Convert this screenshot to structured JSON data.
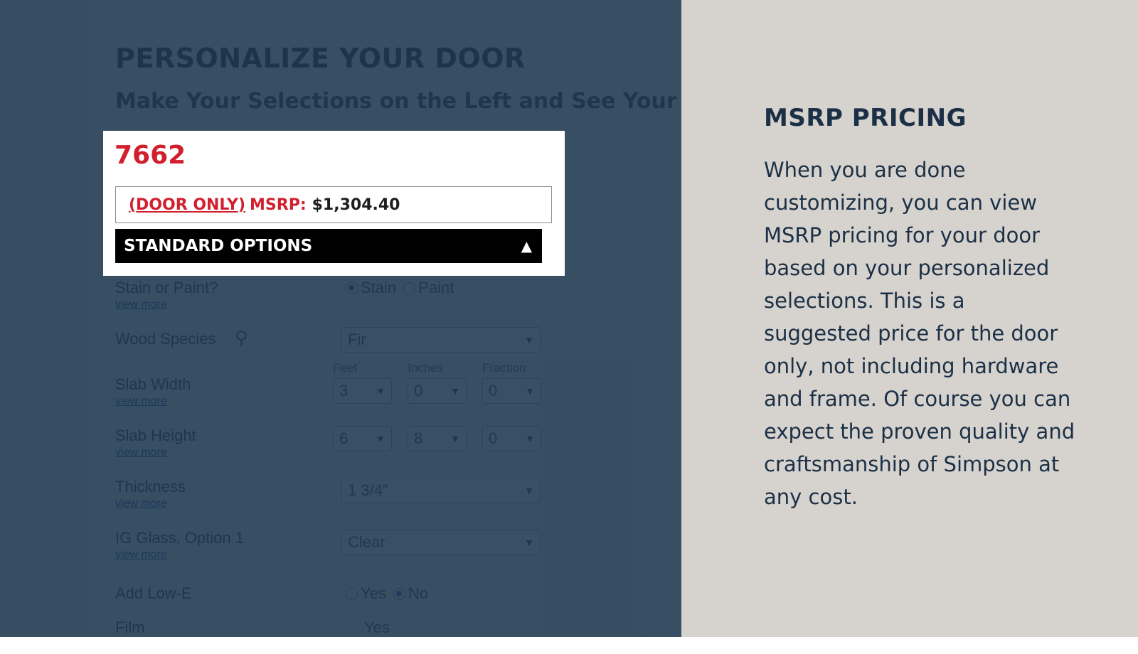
{
  "configurator": {
    "page_title": "PERSONALIZE YOUR DOOR",
    "page_subtitle": "Make Your Selections on the Left and See Your",
    "view_more": "view more",
    "stain_or_paint": {
      "label": "Stain or Paint?",
      "options": [
        "Stain",
        "Paint"
      ],
      "selected": "Stain"
    },
    "wood_species": {
      "label": "Wood Species",
      "value": "Fir"
    },
    "dimension_headers": [
      "Feet",
      "Inches",
      "Fraction"
    ],
    "slab_width": {
      "label": "Slab Width",
      "values": [
        "3",
        "0",
        "0"
      ]
    },
    "slab_height": {
      "label": "Slab Height",
      "values": [
        "6",
        "8",
        "0"
      ]
    },
    "thickness": {
      "label": "Thickness",
      "value": "1 3/4\""
    },
    "ig_glass": {
      "label": "IG Glass, Option 1",
      "value": "Clear"
    },
    "low_e": {
      "label": "Add Low-E",
      "options": [
        "Yes",
        "No"
      ],
      "selected": "No"
    },
    "film": {
      "label": "Film",
      "value": "Yes"
    }
  },
  "callout": {
    "model_number": "7662",
    "door_only": "(DOOR ONLY)",
    "msrp_label": "MSRP:",
    "price": "$1,304.40",
    "standard_options": "STANDARD OPTIONS",
    "toggle_glyph": "▲"
  },
  "info_panel": {
    "title": "MSRP PRICING",
    "body": "When you are done customizing, you can view MSRP pricing for your door based on your personalized selections. This is a suggested price for the door only, not including hardware and frame. Of course you can expect the proven quality and craftsmanship of Simpson at any cost."
  },
  "colors": {
    "overlay": "#1e374e",
    "accent_red": "#d21f2e",
    "panel_bg": "#d6d2cd",
    "panel_text": "#1b3046"
  }
}
